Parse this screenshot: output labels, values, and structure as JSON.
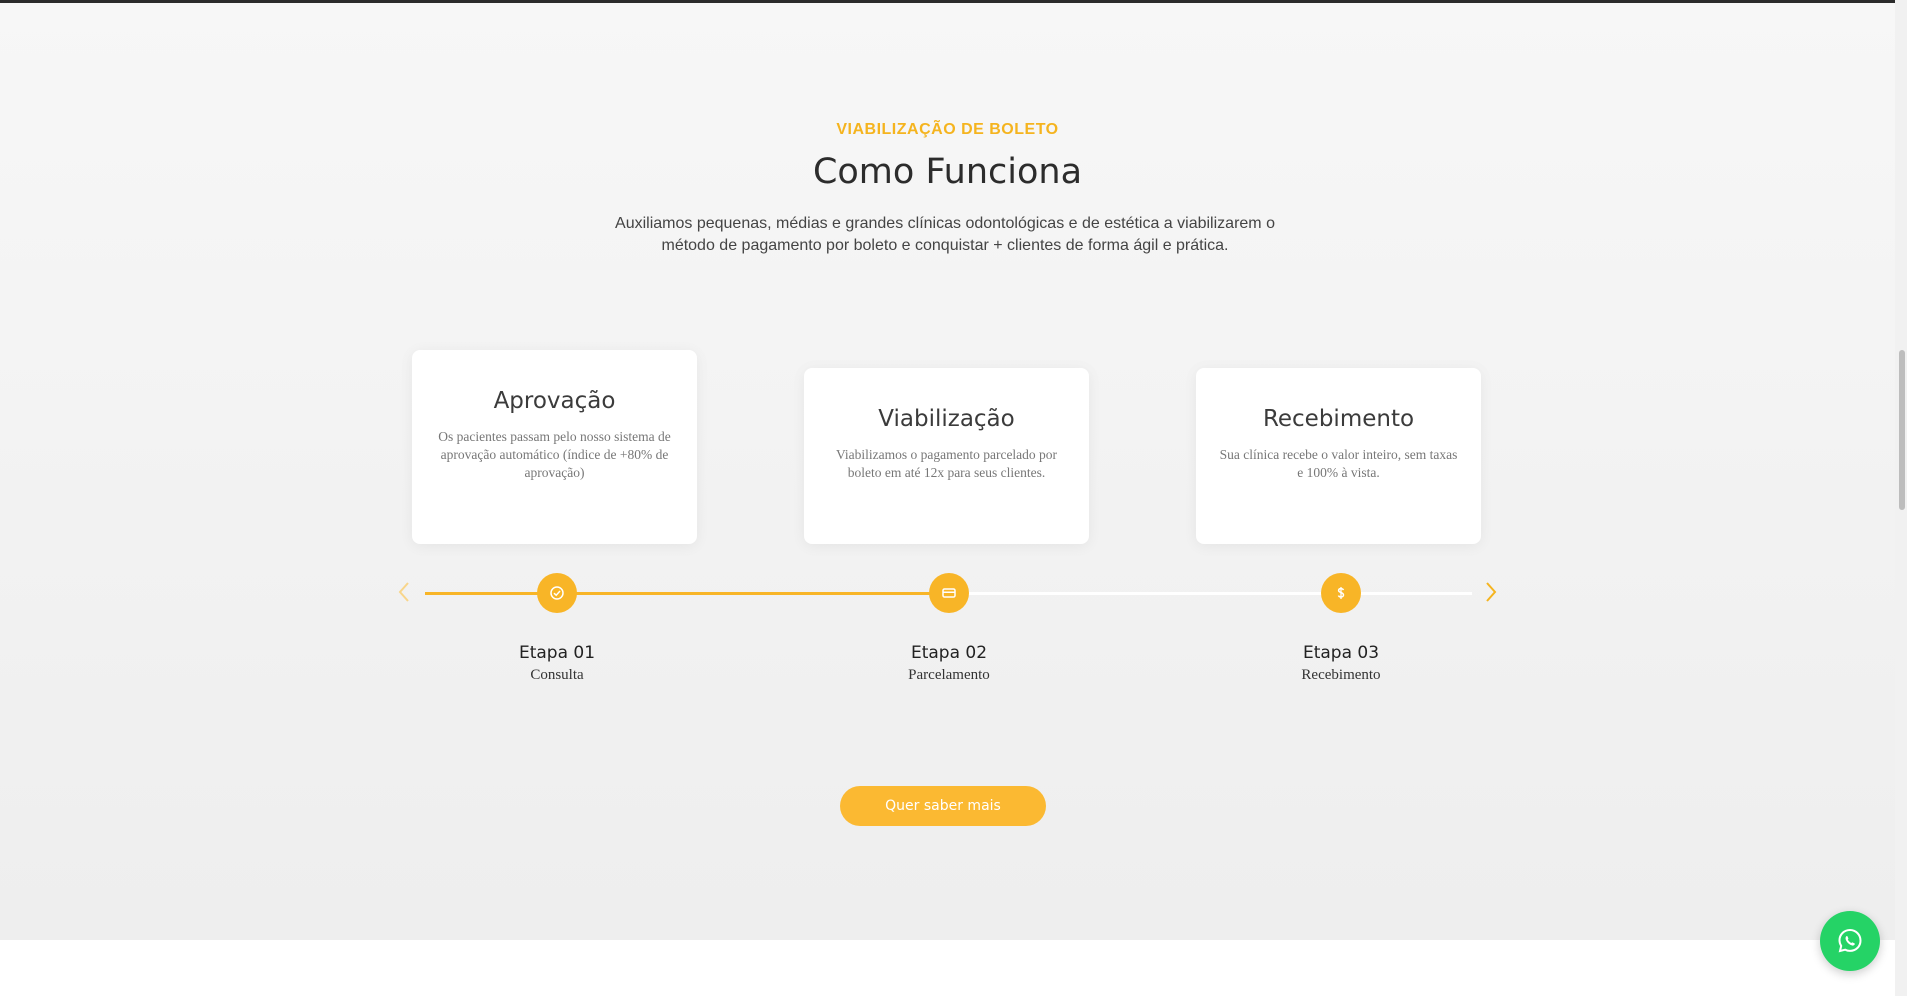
{
  "header": {
    "eyebrow": "VIABILIZAÇÃO DE BOLETO",
    "title": "Como Funciona",
    "description": "Auxiliamos pequenas, médias e grandes clínicas odontológicas e de estética a viabilizarem o método de pagamento por boleto e conquistar + clientes de forma ágil e prática."
  },
  "cards": [
    {
      "title": "Aprovação",
      "text": "Os pacientes passam pelo nosso sistema de aprovação automático (índice de +80% de aprovação)"
    },
    {
      "title": "Viabilização",
      "text": "Viabilizamos o pagamento parcelado por boleto em até 12x para seus clientes."
    },
    {
      "title": "Recebimento",
      "text": "Sua clínica recebe o valor inteiro, sem taxas e 100% à vista."
    }
  ],
  "steps": [
    {
      "name": "Etapa 01",
      "sub": "Consulta",
      "icon": "check-circle-icon"
    },
    {
      "name": "Etapa 02",
      "sub": "Parcelamento",
      "icon": "credit-card-icon"
    },
    {
      "name": "Etapa 03",
      "sub": "Recebimento",
      "icon": "dollar-icon"
    }
  ],
  "cta": {
    "label": "Quer saber mais"
  },
  "colors": {
    "accent": "#f8b527",
    "whatsapp": "#25d366",
    "track_inactive": "#ffffff"
  }
}
